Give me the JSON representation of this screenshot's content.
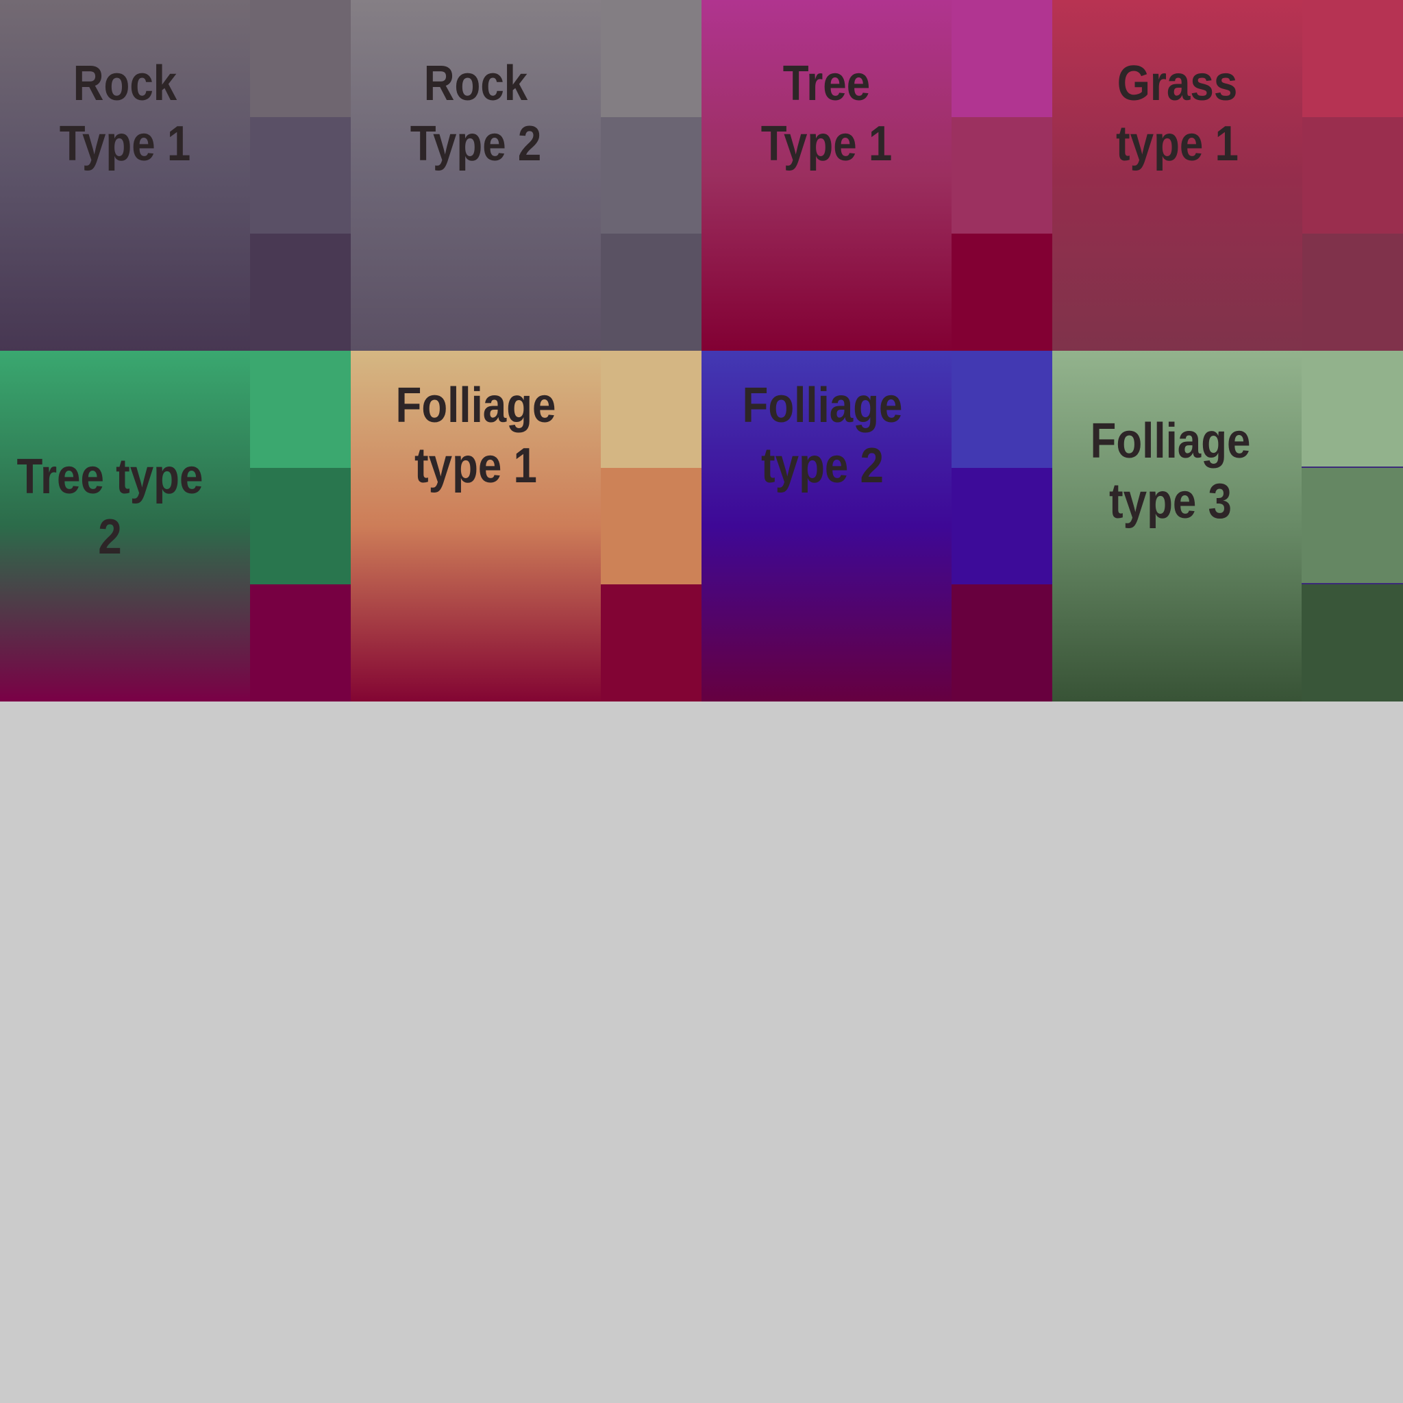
{
  "tiles": [
    {
      "label": "Rock\nType 1",
      "colors": [
        "#6f6670",
        "#5a5066",
        "#493953"
      ],
      "gradient": [
        "#736a73",
        "#5c5368",
        "#473752"
      ]
    },
    {
      "label": "Rock\nType 2",
      "colors": [
        "#837e83",
        "#6b6573",
        "#5a5263"
      ],
      "gradient": [
        "#857f85",
        "#6d6676",
        "#5b5064"
      ]
    },
    {
      "label": "Tree\nType 1",
      "colors": [
        "#b13591",
        "#9c3160",
        "#820033"
      ],
      "gradient": [
        "#b0348f",
        "#9b2f5f",
        "#820033"
      ]
    },
    {
      "label": "Grass\ntype 1",
      "colors": [
        "#b63353",
        "#9a2e4e",
        "#80324b"
      ],
      "gradient": [
        "#b83352",
        "#952d4c",
        "#7f334b"
      ]
    },
    {
      "label": "Tree type\n2",
      "colors": [
        "#3ba86f",
        "#29764e",
        "#770042"
      ],
      "gradient": [
        "#3aa870",
        "#2c6b4a",
        "#7a0046"
      ]
    },
    {
      "label": "Folliage\ntype 1",
      "colors": [
        "#d4b683",
        "#cd8257",
        "#820434"
      ],
      "gradient": [
        "#d5b783",
        "#cd7d58",
        "#830533"
      ]
    },
    {
      "label": "Folliage\ntype 2",
      "colors": [
        "#4239b2",
        "#3d0b99",
        "#68003e"
      ],
      "gradient": [
        "#4339b3",
        "#3e0896",
        "#660040"
      ]
    },
    {
      "label": "Folliage\ntype 3",
      "colors": [
        "#92b28c",
        "#658763",
        "#395639"
      ],
      "gradient": [
        "#93b38d",
        "#688a66",
        "#385336"
      ]
    }
  ]
}
